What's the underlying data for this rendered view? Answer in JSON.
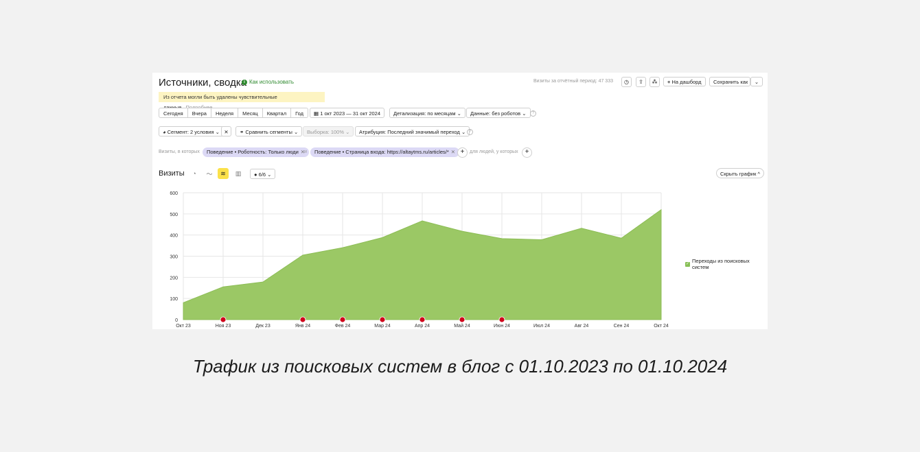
{
  "header": {
    "title": "Источники, сводка",
    "howto_label": "Как использовать",
    "visits_total": "Визиты за отчётный период: 47 333",
    "dashboard_label": "На дашборд",
    "save_label": "Сохранить как"
  },
  "notice": {
    "text": "Из отчета могли быть удалены чувствительные данные.",
    "more": "Подробнее"
  },
  "periods": [
    "Сегодня",
    "Вчера",
    "Неделя",
    "Месяц",
    "Квартал",
    "Год"
  ],
  "date_range": "1 окт 2023 — 31 окт 2024",
  "detail_label": "Детализация: по месяцам",
  "data_label": "Данные: без роботов",
  "segment_label": "Сегмент: 2 условия",
  "compare_label": "Сравнить сегменты",
  "sample_label": "Выборка: 100%",
  "attribution_label": "Атрибуция: Последний значимый переход",
  "filters": {
    "prefix": "Визиты, в которых",
    "chip1": "Поведение • Роботность: Только люди",
    "and": "и",
    "chip2": "Поведение • Страница входа: https://altaytms.ru/articles/*",
    "suffix": "для людей, у которых"
  },
  "chart_section": {
    "title": "Визиты",
    "annotations_label": "6/6",
    "hide_label": "Скрыть график"
  },
  "colors": {
    "area": "#9bc865",
    "accent": "#fbe14a",
    "marker": "#d0021b"
  },
  "chart_data": {
    "type": "area",
    "categories": [
      "Окт 23",
      "Ноя 23",
      "Дек 23",
      "Янв 24",
      "Фев 24",
      "Мар 24",
      "Апр 24",
      "Май 24",
      "Июн 24",
      "Июл 24",
      "Авг 24",
      "Сен 24",
      "Окт 24"
    ],
    "series": [
      {
        "name": "Переходы из поисковых систем",
        "values": [
          80,
          155,
          178,
          305,
          340,
          388,
          467,
          418,
          383,
          378,
          432,
          385,
          520
        ]
      }
    ],
    "ylim": [
      0,
      600
    ],
    "yticks": [
      0,
      100,
      200,
      300,
      400,
      500,
      600
    ],
    "grid": true,
    "legend": "right",
    "annotation_markers": [
      1,
      3,
      4,
      5,
      6,
      7,
      8
    ]
  },
  "caption": "Трафик из поисковых систем в блог с 01.10.2023 по 01.10.2024"
}
